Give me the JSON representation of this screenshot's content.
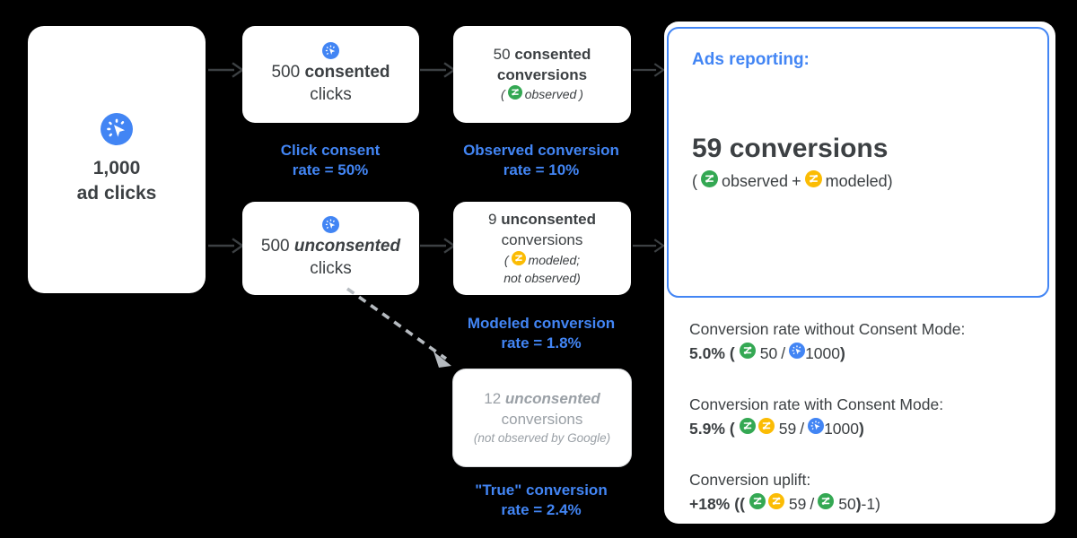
{
  "colors": {
    "blue": "#4285f4",
    "green": "#34a853",
    "yellow": "#fbbc04",
    "text": "#3c4043",
    "muted": "#9aa0a6",
    "background": "#000000"
  },
  "flow": {
    "source": {
      "icon": "ad-click-icon",
      "value": "1,000",
      "label": "ad clicks"
    },
    "clicks": [
      {
        "id": "consented-clicks",
        "icon": "ad-click-icon",
        "value": "500",
        "emphasis": "consented",
        "label": "clicks"
      },
      {
        "id": "unconsented-clicks",
        "icon": "ad-click-icon",
        "value": "500",
        "emphasis": "unconsented",
        "label": "clicks"
      }
    ],
    "conversions": [
      {
        "id": "consented-conversions",
        "value": "50",
        "emphasis": "consented",
        "label": "conversions",
        "note_prefix": "(",
        "note_icon": "analytics-green-icon",
        "note_text": "observed",
        "note_suffix": ")",
        "note_line2": ""
      },
      {
        "id": "unconsented-conversions",
        "value": "9",
        "emphasis": "unconsented",
        "label": "conversions",
        "note_prefix": "(",
        "note_icon": "analytics-yellow-icon",
        "note_text": "modeled;",
        "note_suffix": "",
        "note_line2": "not observed)"
      },
      {
        "id": "true-conversions",
        "value": "12",
        "emphasis": "unconsented",
        "label": "conversions",
        "note_prefix": "",
        "note_icon": "",
        "note_text": "(not observed by Google)",
        "note_suffix": "",
        "note_line2": ""
      }
    ],
    "rate_labels": [
      {
        "id": "click-consent-rate",
        "line1": "Click consent",
        "line2_prefix": "rate = ",
        "line2_value": "50%"
      },
      {
        "id": "observed-conversion-rate",
        "line1": "Observed conversion",
        "line2_prefix": "rate = ",
        "line2_value": "10%"
      },
      {
        "id": "modeled-conversion-rate",
        "line1": "Modeled conversion",
        "line2_prefix": "rate = ",
        "line2_value": "1.8%"
      },
      {
        "id": "true-conversion-rate",
        "line1": "\"True\" conversion",
        "line2_prefix": "rate = ",
        "line2_value": "2.4%"
      }
    ]
  },
  "report": {
    "title": "Ads reporting:",
    "headline": "59 conversions",
    "subline": {
      "open": "(",
      "observed_icon": "analytics-green-icon",
      "observed_text": "observed",
      "plus": "+",
      "modeled_icon": "analytics-yellow-icon",
      "modeled_text": "modeled",
      "close": ")"
    },
    "calculations": [
      {
        "id": "cr-without-consent-mode",
        "title": "Conversion rate without Consent Mode:",
        "value": "5.0%",
        "open": "(",
        "numerator_icons": [
          "analytics-green-icon"
        ],
        "numerator": "50",
        "divider": "/",
        "denominator_icons": [
          "ad-click-icon"
        ],
        "denominator": "1000",
        "close": ")",
        "tail": ""
      },
      {
        "id": "cr-with-consent-mode",
        "title": "Conversion rate with Consent Mode:",
        "value": "5.9%",
        "open": "(",
        "numerator_icons": [
          "analytics-green-icon",
          "analytics-yellow-icon"
        ],
        "numerator": "59",
        "divider": "/",
        "denominator_icons": [
          "ad-click-icon"
        ],
        "denominator": "1000",
        "close": ")",
        "tail": ""
      },
      {
        "id": "conversion-uplift",
        "title": "Conversion uplift:",
        "value": "+18%",
        "open": "((",
        "numerator_icons": [
          "analytics-green-icon",
          "analytics-yellow-icon"
        ],
        "numerator": "59",
        "divider": "/",
        "denominator_icons": [
          "analytics-green-icon"
        ],
        "denominator": "50",
        "close": ")",
        "tail": "-1)"
      }
    ]
  }
}
